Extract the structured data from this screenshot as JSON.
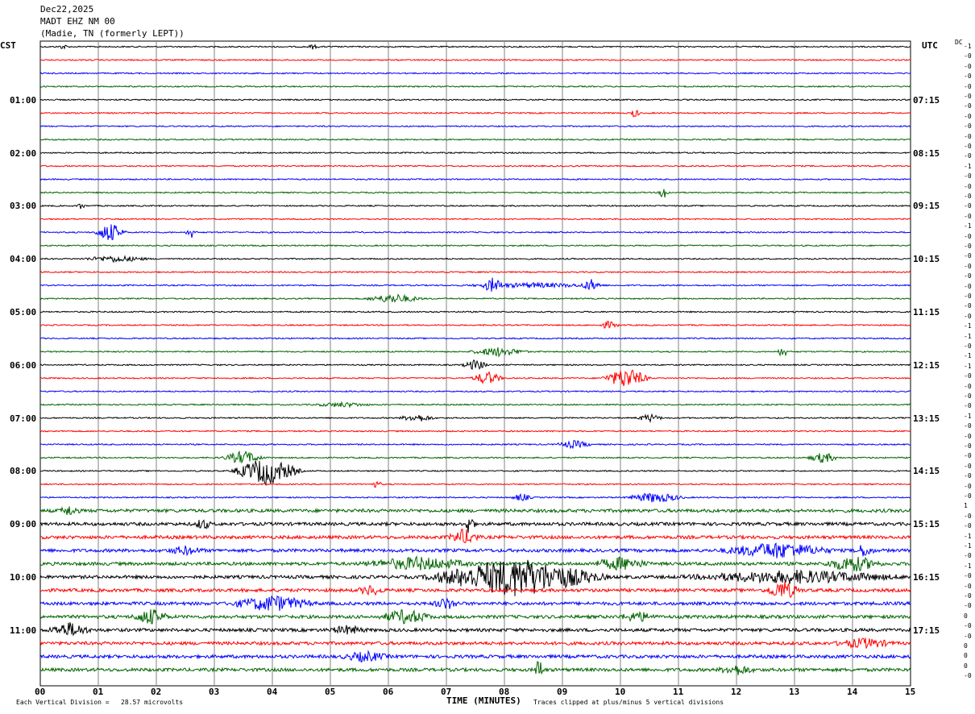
{
  "header": {
    "date": "Dec22,2025",
    "station": "MADT EHZ NM 00",
    "location": "(Madie, TN (formerly LEPT))"
  },
  "left_axis_label": "CST",
  "right_axis_label": "UTC",
  "dc_label": "DC",
  "left_times": [
    "01:00",
    "02:00",
    "03:00",
    "04:00",
    "05:00",
    "06:00",
    "07:00",
    "08:00",
    "09:00",
    "10:00",
    "11:00"
  ],
  "right_times": [
    "07:15",
    "08:15",
    "09:15",
    "10:15",
    "11:15",
    "12:15",
    "13:15",
    "14:15",
    "15:15",
    "16:15",
    "17:15"
  ],
  "x_ticks": [
    "00",
    "01",
    "02",
    "03",
    "04",
    "05",
    "06",
    "07",
    "08",
    "09",
    "10",
    "11",
    "12",
    "13",
    "14",
    "15"
  ],
  "x_label": "TIME (MINUTES)",
  "footer_left": "Each Vertical Division =   28.57 microvolts",
  "footer_right": "Traces clipped at plus/minus 5 vertical divisions",
  "dc_offsets": [
    "-1",
    "-0",
    "-0",
    "-0",
    "-0",
    "-0",
    "-0",
    "-0",
    "-0",
    "-0",
    "-0",
    "-0",
    "-1",
    "-0",
    "-0",
    "-0",
    "-0",
    "-0",
    "-1",
    "-0",
    "-0",
    "-0",
    "-0",
    "-0",
    "-0",
    "-0",
    "-0",
    "-0",
    "-1",
    "-1",
    "-0",
    "-1",
    "-1",
    "-0",
    "-0",
    "-0",
    "-0",
    "-1",
    "-0",
    "-0",
    "-0",
    "-0",
    "-0",
    "-0",
    "-0",
    "-0",
    "1",
    "-0",
    "-0",
    "-1",
    "-1",
    "-0",
    "-1",
    "-0",
    "-0",
    "-0",
    "-0",
    "0",
    "-0",
    "-0",
    "0",
    "0",
    "0",
    "-0"
  ],
  "colors": {
    "black": "#000000",
    "red": "#ff0000",
    "blue": "#0000ff",
    "green": "#006400",
    "grid": "#808080"
  },
  "chart_data": {
    "type": "line",
    "title": "MADT EHZ NM 00",
    "xlabel": "TIME (MINUTES)",
    "xlim": [
      0,
      15
    ],
    "trace_count": 48,
    "trace_interval_minutes": 15,
    "trace_colors_cycle": [
      "black",
      "red",
      "blue",
      "green"
    ],
    "events": [
      {
        "trace": 0,
        "minute": 0.4,
        "amp": 0.3,
        "dur": 0.1
      },
      {
        "trace": 0,
        "minute": 4.7,
        "amp": 0.3,
        "dur": 0.1
      },
      {
        "trace": 5,
        "minute": 10.25,
        "amp": 0.6,
        "dur": 0.1
      },
      {
        "trace": 11,
        "minute": 10.75,
        "amp": 1.0,
        "dur": 0.1
      },
      {
        "trace": 12,
        "minute": 0.7,
        "amp": 0.5,
        "dur": 0.05
      },
      {
        "trace": 14,
        "minute": 1.2,
        "amp": 1.3,
        "dur": 0.5
      },
      {
        "trace": 14,
        "minute": 2.6,
        "amp": 0.8,
        "dur": 0.1
      },
      {
        "trace": 16,
        "minute": 1.3,
        "amp": 0.4,
        "dur": 1.2
      },
      {
        "trace": 18,
        "minute": 7.8,
        "amp": 0.9,
        "dur": 0.3
      },
      {
        "trace": 18,
        "minute": 9.5,
        "amp": 0.7,
        "dur": 0.3
      },
      {
        "trace": 18,
        "minute": 8.5,
        "amp": 0.3,
        "dur": 2.5
      },
      {
        "trace": 19,
        "minute": 6.1,
        "amp": 0.6,
        "dur": 1.0
      },
      {
        "trace": 21,
        "minute": 9.8,
        "amp": 0.5,
        "dur": 0.3
      },
      {
        "trace": 23,
        "minute": 7.9,
        "amp": 0.6,
        "dur": 1.0
      },
      {
        "trace": 23,
        "minute": 12.8,
        "amp": 0.8,
        "dur": 0.1
      },
      {
        "trace": 24,
        "minute": 7.5,
        "amp": 0.7,
        "dur": 0.4
      },
      {
        "trace": 25,
        "minute": 7.7,
        "amp": 0.9,
        "dur": 0.5
      },
      {
        "trace": 25,
        "minute": 10.1,
        "amp": 1.4,
        "dur": 0.8
      },
      {
        "trace": 27,
        "minute": 5.2,
        "amp": 0.3,
        "dur": 1.0
      },
      {
        "trace": 28,
        "minute": 6.5,
        "amp": 0.5,
        "dur": 0.6
      },
      {
        "trace": 28,
        "minute": 10.5,
        "amp": 0.5,
        "dur": 0.4
      },
      {
        "trace": 30,
        "minute": 9.2,
        "amp": 0.5,
        "dur": 0.6
      },
      {
        "trace": 31,
        "minute": 3.5,
        "amp": 0.9,
        "dur": 0.7
      },
      {
        "trace": 31,
        "minute": 13.5,
        "amp": 0.7,
        "dur": 0.5
      },
      {
        "trace": 32,
        "minute": 3.9,
        "amp": 1.9,
        "dur": 1.2
      },
      {
        "trace": 33,
        "minute": 5.8,
        "amp": 0.5,
        "dur": 0.1
      },
      {
        "trace": 34,
        "minute": 10.6,
        "amp": 0.7,
        "dur": 1.0
      },
      {
        "trace": 34,
        "minute": 8.3,
        "amp": 0.5,
        "dur": 0.3
      },
      {
        "trace": 35,
        "minute": 0.5,
        "amp": 0.6,
        "dur": 0.3
      },
      {
        "trace": 36,
        "minute": 7.4,
        "amp": 1.6,
        "dur": 0.1
      },
      {
        "trace": 36,
        "minute": 2.8,
        "amp": 0.7,
        "dur": 0.2
      },
      {
        "trace": 37,
        "minute": 7.3,
        "amp": 1.0,
        "dur": 0.5
      },
      {
        "trace": 38,
        "minute": 12.7,
        "amp": 1.0,
        "dur": 2.0
      },
      {
        "trace": 38,
        "minute": 14.2,
        "amp": 0.8,
        "dur": 0.3
      },
      {
        "trace": 38,
        "minute": 2.5,
        "amp": 0.5,
        "dur": 0.6
      },
      {
        "trace": 39,
        "minute": 14.0,
        "amp": 1.0,
        "dur": 1.0
      },
      {
        "trace": 39,
        "minute": 6.5,
        "amp": 0.8,
        "dur": 2.0
      },
      {
        "trace": 39,
        "minute": 10.0,
        "amp": 0.8,
        "dur": 1.0
      },
      {
        "trace": 40,
        "minute": 8.2,
        "amp": 2.6,
        "dur": 3.2
      },
      {
        "trace": 40,
        "minute": 13.0,
        "amp": 0.8,
        "dur": 4.0
      },
      {
        "trace": 41,
        "minute": 12.8,
        "amp": 1.2,
        "dur": 0.6
      },
      {
        "trace": 41,
        "minute": 5.7,
        "amp": 0.6,
        "dur": 0.4
      },
      {
        "trace": 42,
        "minute": 4.0,
        "amp": 1.0,
        "dur": 1.5
      },
      {
        "trace": 42,
        "minute": 7.0,
        "amp": 0.7,
        "dur": 0.4
      },
      {
        "trace": 43,
        "minute": 1.9,
        "amp": 1.0,
        "dur": 0.6
      },
      {
        "trace": 43,
        "minute": 6.3,
        "amp": 0.9,
        "dur": 0.9
      },
      {
        "trace": 43,
        "minute": 10.3,
        "amp": 0.6,
        "dur": 0.6
      },
      {
        "trace": 44,
        "minute": 0.5,
        "amp": 0.9,
        "dur": 0.7
      },
      {
        "trace": 44,
        "minute": 5.3,
        "amp": 0.5,
        "dur": 0.6
      },
      {
        "trace": 45,
        "minute": 14.2,
        "amp": 0.6,
        "dur": 1.0
      },
      {
        "trace": 46,
        "minute": 5.6,
        "amp": 0.6,
        "dur": 0.8
      },
      {
        "trace": 47,
        "minute": 12.0,
        "amp": 0.6,
        "dur": 0.6
      },
      {
        "trace": 47,
        "minute": 8.6,
        "amp": 1.5,
        "dur": 0.1
      }
    ]
  }
}
